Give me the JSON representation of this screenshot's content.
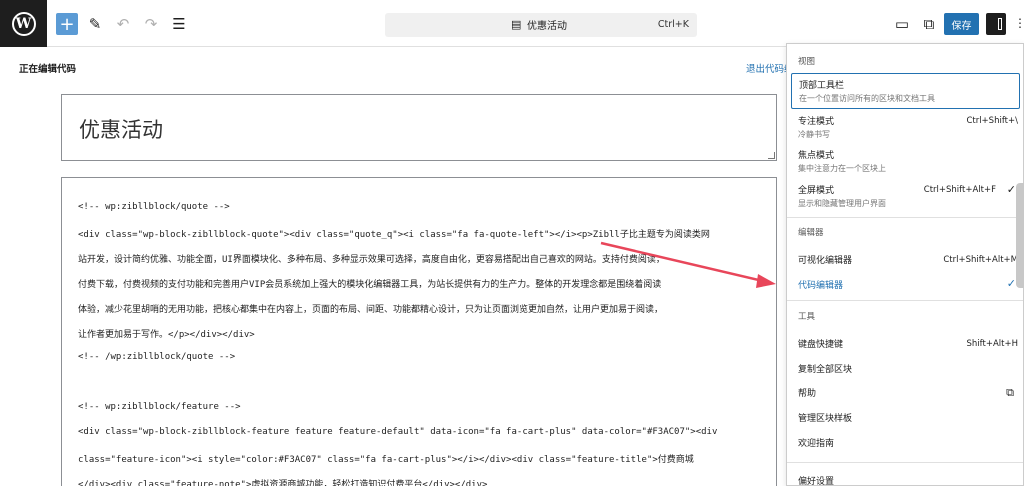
{
  "toolbar": {
    "add_icon": "plus-icon",
    "doc_title": "优惠活动",
    "doc_shortcut": "Ctrl+K",
    "save_label": "保存"
  },
  "code_editor": {
    "label": "正在编辑代码",
    "exit_label": "退出代码编辑器"
  },
  "post": {
    "title": "优惠活动",
    "code_lines": [
      "<!-- wp:zibllblock/quote -->",
      "<div class=\"wp-block-zibllblock-quote\"><div class=\"quote_q\"><i class=\"fa fa-quote-left\"></i><p>Zibll子比主题专为阅读类网",
      "站开发，设计简约优雅、功能全面，UI界面模块化、多种布局、多种显示效果可选择，高度自由化，更容易搭配出自己喜欢的网站。支持付费阅读，",
      "付费下载，付费视频的支付功能和完善用户VIP会员系统加上强大的模块化编辑器工具，为站长提供有力的生产力。整体的开发理念都是围绕着阅读",
      "体验，减少花里胡哨的无用功能，把核心都集中在内容上，页面的布局、间距、功能都精心设计，只为让页面浏览更加自然，让用户更加易于阅读，",
      "让作者更加易于写作。</p></div></div>",
      "<!-- /wp:zibllblock/quote -->",
      "",
      "<!-- wp:zibllblock/feature -->",
      "<div class=\"wp-block-zibllblock-feature feature feature-default\" data-icon=\"fa fa-cart-plus\" data-color=\"#F3AC07\"><div",
      "class=\"feature-icon\"><i style=\"color:#F3AC07\" class=\"fa fa-cart-plus\"></i></div><div class=\"feature-title\">付费商城",
      "</div><div class=\"feature-note\">虚拟资源商城功能，轻松打造知识付费平台</div></div>"
    ]
  },
  "menu": {
    "view_label": "视图",
    "top_toolbar": {
      "label": "顶部工具栏",
      "desc": "在一个位置访问所有的区块和文档工具"
    },
    "spotlight": {
      "label": "专注模式",
      "desc": "冷静书写",
      "shortcut": "Ctrl+Shift+\\"
    },
    "focus": {
      "label": "焦点模式",
      "desc": "集中注意力在一个区块上"
    },
    "fullscreen": {
      "label": "全屏模式",
      "desc": "显示和隐藏管理用户界面",
      "shortcut": "Ctrl+Shift+Alt+F"
    },
    "editor_label": "编辑器",
    "visual_editor": {
      "label": "可视化编辑器",
      "shortcut": "Ctrl+Shift+Alt+M"
    },
    "code_editor": {
      "label": "代码编辑器"
    },
    "tools_label": "工具",
    "keyboard": {
      "label": "键盘快捷键",
      "shortcut": "Shift+Alt+H"
    },
    "copy_blocks": {
      "label": "复制全部区块"
    },
    "help": {
      "label": "帮助"
    },
    "manage_patterns": {
      "label": "管理区块样板"
    },
    "welcome": {
      "label": "欢迎指南"
    },
    "preferences": {
      "label": "偏好设置"
    }
  },
  "colors": {
    "accent": "#2271b1",
    "arrow": "#e8465a"
  }
}
